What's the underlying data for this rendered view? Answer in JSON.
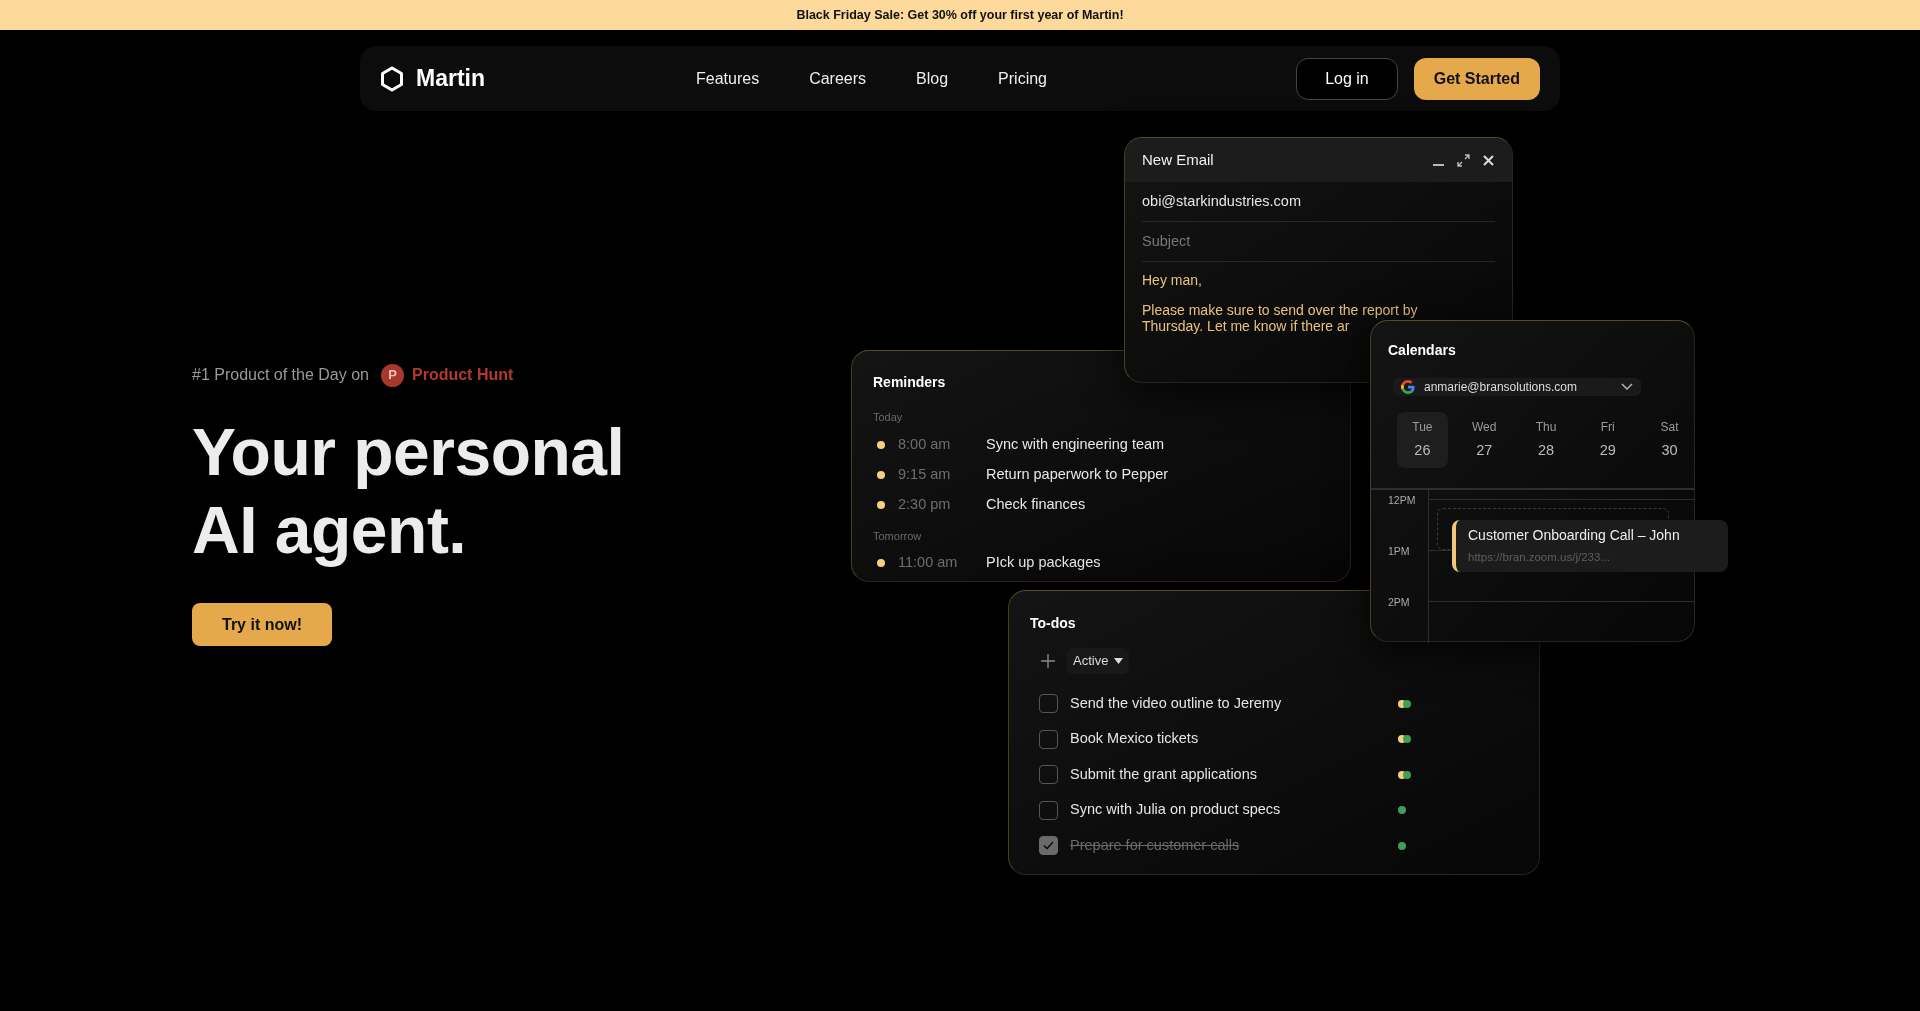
{
  "banner": {
    "text": "Black Friday Sale: Get 30% off your first year of Martin!"
  },
  "nav": {
    "brand": "Martin",
    "links": [
      "Features",
      "Careers",
      "Blog",
      "Pricing"
    ],
    "login": "Log in",
    "cta": "Get Started"
  },
  "hero": {
    "award_prefix": "#1 Product of the Day on",
    "award_badge": "P",
    "award_name": "Product Hunt",
    "headline_lines": [
      "Your personal",
      "AI agent."
    ],
    "cta": "Try it now!"
  },
  "email": {
    "title": "New Email",
    "to": "obi@starkindustries.com",
    "subject_placeholder": "Subject",
    "greeting": "Hey man,",
    "body": "Please make sure to send over the report by Thursday. Let me know if there ar"
  },
  "reminders": {
    "title": "Reminders",
    "groups": [
      {
        "label": "Today",
        "items": [
          {
            "time": "8:00 am",
            "task": "Sync with engineering team"
          },
          {
            "time": "9:15 am",
            "task": "Return paperwork to Pepper"
          },
          {
            "time": "2:30 pm",
            "task": "Check finances"
          }
        ]
      },
      {
        "label": "Tomorrow",
        "items": [
          {
            "time": "11:00 am",
            "task": "PIck up packages"
          }
        ]
      }
    ]
  },
  "calendar": {
    "title": "Calendars",
    "account": "anmarie@bransolutions.com",
    "days": [
      {
        "weekday": "Tue",
        "date": "26",
        "selected": true
      },
      {
        "weekday": "Wed",
        "date": "27",
        "selected": false
      },
      {
        "weekday": "Thu",
        "date": "28",
        "selected": false
      },
      {
        "weekday": "Fri",
        "date": "29",
        "selected": false
      },
      {
        "weekday": "Sat",
        "date": "30",
        "selected": false
      }
    ],
    "hours": [
      "12PM",
      "1PM",
      "2PM"
    ],
    "event": {
      "title": "Customer Onboarding Call – John",
      "link": "https://bran.zoom.us/j/233..."
    }
  },
  "todos": {
    "title": "To-dos",
    "filter": "Active",
    "items": [
      {
        "text": "Send the video outline to Jeremy",
        "checked": false,
        "tags": [
          {
            "color": "#f7cf7d"
          },
          {
            "color": "#3f9e58"
          }
        ]
      },
      {
        "text": "Book Mexico tickets",
        "checked": false,
        "tags": [
          {
            "color": "#f7cf7d"
          },
          {
            "color": "#3f9e58"
          }
        ]
      },
      {
        "text": "Submit the grant applications",
        "checked": false,
        "tags": [
          {
            "color": "#f7cf7d"
          },
          {
            "color": "#3f9e58"
          }
        ]
      },
      {
        "text": "Sync with Julia on product specs",
        "checked": false,
        "tags": [
          {
            "color": "#3f9e58"
          }
        ]
      },
      {
        "text": "Prepare for customer calls",
        "checked": true,
        "tags": [
          {
            "color": "#3f9e58"
          }
        ]
      }
    ]
  }
}
